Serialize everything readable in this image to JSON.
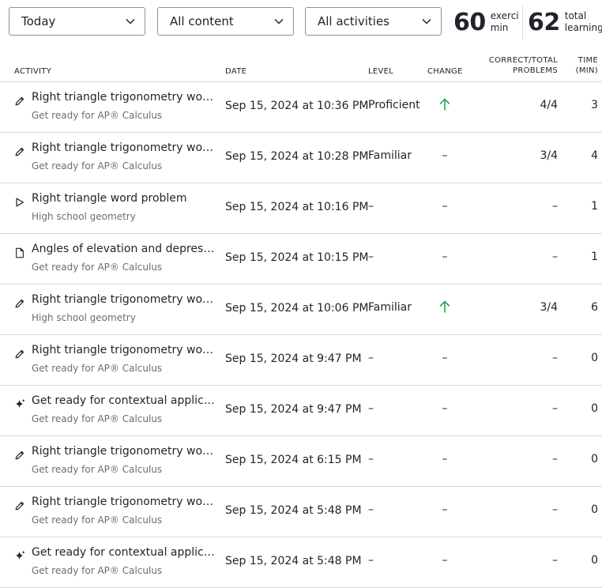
{
  "filters": {
    "date": "Today",
    "content": "All content",
    "activities": "All activities"
  },
  "stats": {
    "exercise_value": "60",
    "exercise_unit": "exercise\nmin",
    "learning_value": "62",
    "learning_unit": "total\nlearning..."
  },
  "columns": {
    "activity": "ACTIVITY",
    "date": "DATE",
    "level": "LEVEL",
    "change": "CHANGE",
    "correct": "CORRECT/TOTAL\nPROBLEMS",
    "time": "TIME\n(MIN)"
  },
  "colors": {
    "up_arrow": "#1fab54",
    "border": "#d6d8da",
    "muted": "#6b6d72"
  },
  "rows": [
    {
      "icon": "pencil-icon",
      "title": "Right triangle trigonometry word problems",
      "course": "Get ready for AP® Calculus",
      "date": "Sep 15, 2024 at 10:36 PM",
      "level": "Proficient",
      "change": "up",
      "correct": "4/4",
      "time": "3"
    },
    {
      "icon": "pencil-icon",
      "title": "Right triangle trigonometry word problems",
      "course": "Get ready for AP® Calculus",
      "date": "Sep 15, 2024 at 10:28 PM",
      "level": "Familiar",
      "change": "–",
      "correct": "3/4",
      "time": "4"
    },
    {
      "icon": "play-icon",
      "title": "Right triangle word problem",
      "course": "High school geometry",
      "date": "Sep 15, 2024 at 10:16 PM",
      "level": "–",
      "change": "–",
      "correct": "–",
      "time": "1"
    },
    {
      "icon": "article-icon",
      "title": "Angles of elevation and depression",
      "course": "Get ready for AP® Calculus",
      "date": "Sep 15, 2024 at 10:15 PM",
      "level": "–",
      "change": "–",
      "correct": "–",
      "time": "1"
    },
    {
      "icon": "pencil-icon",
      "title": "Right triangle trigonometry word problems",
      "course": "High school geometry",
      "date": "Sep 15, 2024 at 10:06 PM",
      "level": "Familiar",
      "change": "up",
      "correct": "3/4",
      "time": "6"
    },
    {
      "icon": "pencil-icon",
      "title": "Right triangle trigonometry word problems",
      "course": "Get ready for AP® Calculus",
      "date": "Sep 15, 2024 at 9:47 PM",
      "level": "–",
      "change": "–",
      "correct": "–",
      "time": "0"
    },
    {
      "icon": "sparkle-icon",
      "title": "Get ready for contextual applications",
      "course": "Get ready for AP® Calculus",
      "date": "Sep 15, 2024 at 9:47 PM",
      "level": "–",
      "change": "–",
      "correct": "–",
      "time": "0"
    },
    {
      "icon": "pencil-icon",
      "title": "Right triangle trigonometry word problems",
      "course": "Get ready for AP® Calculus",
      "date": "Sep 15, 2024 at 6:15 PM",
      "level": "–",
      "change": "–",
      "correct": "–",
      "time": "0"
    },
    {
      "icon": "pencil-icon",
      "title": "Right triangle trigonometry word problems",
      "course": "Get ready for AP® Calculus",
      "date": "Sep 15, 2024 at 5:48 PM",
      "level": "–",
      "change": "–",
      "correct": "–",
      "time": "0"
    },
    {
      "icon": "sparkle-icon",
      "title": "Get ready for contextual applications",
      "course": "Get ready for AP® Calculus",
      "date": "Sep 15, 2024 at 5:48 PM",
      "level": "–",
      "change": "–",
      "correct": "–",
      "time": "0"
    }
  ]
}
